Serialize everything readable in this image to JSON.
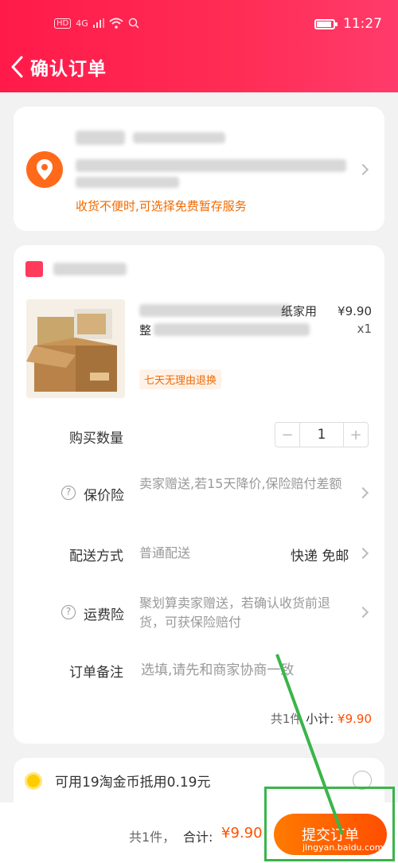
{
  "status_bar": {
    "left_badge": "HD",
    "signal_label": "4G",
    "time": "11:27",
    "battery_level": 0.9
  },
  "header": {
    "title": "确认订单"
  },
  "address": {
    "note": "收货不便时,可选择免费暂存服务"
  },
  "product": {
    "title_visible": "纸家用",
    "title_line2_visible": "整",
    "price": "¥9.90",
    "quantity": "x1",
    "tag": "七天无理由退换"
  },
  "order": {
    "quantity_label": "购买数量",
    "quantity_value": "1",
    "insurance_label": "保价险",
    "insurance_value": "卖家赠送,若15天降价,保险赔付差额",
    "delivery_label": "配送方式",
    "delivery_value": "普通配送",
    "delivery_right": "快递 免邮",
    "freight_label": "运费险",
    "freight_value": "聚划算卖家赠送，若确认收货前退货，可获保险赔付",
    "remark_label": "订单备注",
    "remark_placeholder": "选填,请先和商家协商一致",
    "subtotal_count": "共1件",
    "subtotal_label": "小计:",
    "subtotal_value": "¥9.90"
  },
  "coins": {
    "text": "可用19淘金币抵用0.19元"
  },
  "footer": {
    "count": "共1件，",
    "total_label": "合计:",
    "total_value": "¥9.90",
    "submit_label": "提交订单"
  },
  "watermark": "jingyan.baidu.com",
  "colors": {
    "brand": "#ff2d55",
    "accent": "#ff5000",
    "annotation": "#3ab54a"
  }
}
